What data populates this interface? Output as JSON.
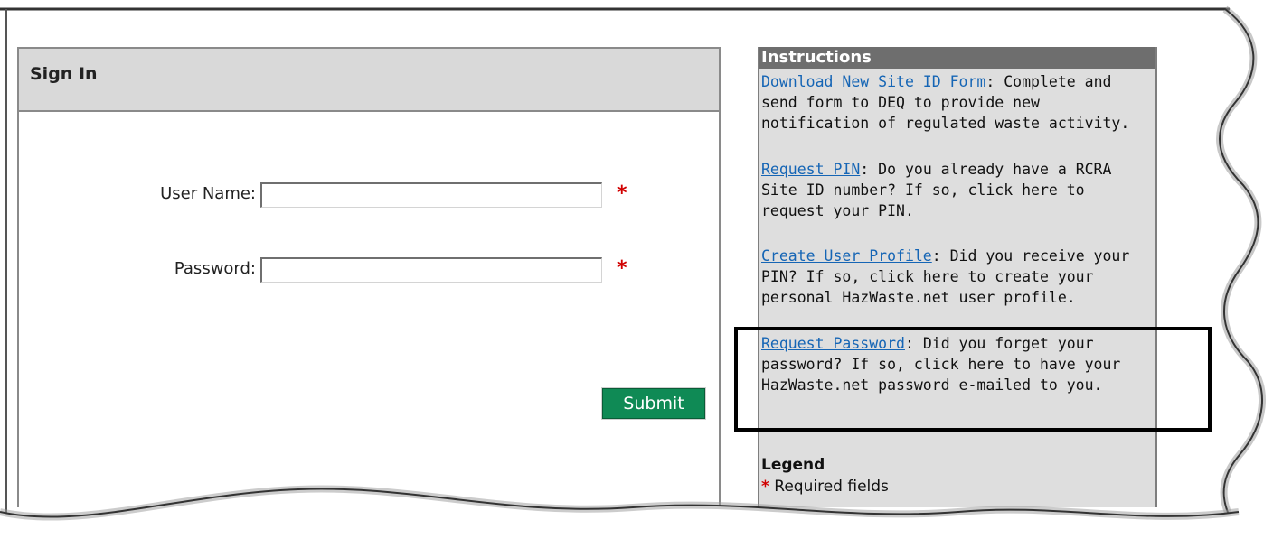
{
  "signin": {
    "title": "Sign In",
    "username_label": "User Name:",
    "username_value": "",
    "password_label": "Password:",
    "password_value": "",
    "required_marker": "*",
    "submit_label": "Submit"
  },
  "instructions": {
    "title": "Instructions",
    "items": [
      {
        "link": "Download New Site ID Form",
        "text": ": Complete and send form to DEQ to provide new notification of regulated waste activity."
      },
      {
        "link": "Request PIN",
        "text": ": Do you already have a RCRA Site ID number? If so, click here to request your PIN."
      },
      {
        "link": "Create User Profile",
        "text": ": Did you receive your PIN? If so, click here to create your personal HazWaste.net user profile."
      },
      {
        "link": "Request Password",
        "text": ": Did you forget your password? If so, click here to have your HazWaste.net password e-mailed to you."
      }
    ],
    "legend_title": "Legend",
    "legend_marker": "*",
    "legend_text": "Required fields"
  },
  "colors": {
    "link": "#1565b5",
    "submit_bg": "#0f8a55",
    "required": "#d10000",
    "instr_header_bg": "#6e6e6e",
    "panel_bg": "#dedede"
  }
}
